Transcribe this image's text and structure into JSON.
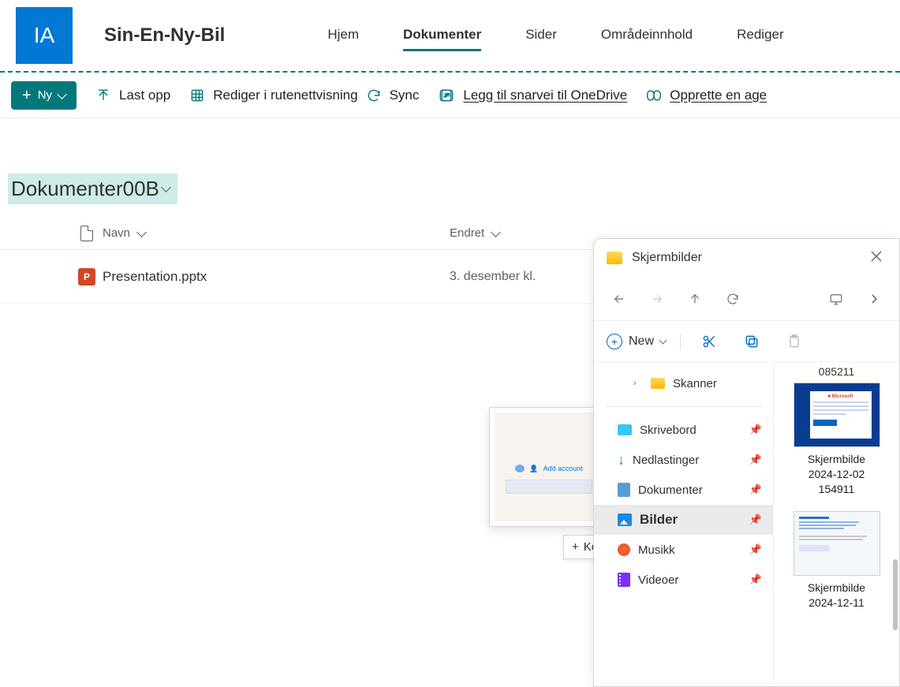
{
  "site": {
    "logo_initials": "IA",
    "title": "Sin-En-Ny-Bil",
    "nav": {
      "home": "Hjem",
      "documents": "Dokumenter",
      "pages": "Sider",
      "site_contents": "Områdeinnhold",
      "edit": "Rediger"
    }
  },
  "commands": {
    "new": "Ny",
    "upload": "Last opp",
    "edit_grid": "Rediger i rutenettvisning",
    "sync": "Sync",
    "add_shortcut": "Legg til snarvei til OneDrive",
    "create_agent": "Opprette en age"
  },
  "library": {
    "title_prefix": "Dokumenter ",
    "title_suffix": "00B"
  },
  "columns": {
    "name": "Navn",
    "modified": "Endret"
  },
  "file": {
    "name": "Presentation.pptx",
    "modified": "3. desember kl."
  },
  "drag": {
    "ghost_label": "Add account",
    "tooltip": "Kopier-knappen."
  },
  "explorer": {
    "title": "Skjermbilder",
    "new_button": "New",
    "tree": {
      "skanner": "Skanner",
      "skrivebord": "Skrivebord",
      "nedlastinger": "Nedlastinger",
      "dokumenter": "Dokumenter",
      "bilder": "Bilder",
      "musikk": "Musikk",
      "videoer": "Videoer"
    },
    "content": {
      "top_partial": "085211",
      "thumb1_line1": "Skjermbilde",
      "thumb1_line2": "2024-12-02",
      "thumb1_line3": "154911",
      "thumb2_line1": "Skjermbilde",
      "thumb2_line2": "2024-12-11"
    }
  }
}
